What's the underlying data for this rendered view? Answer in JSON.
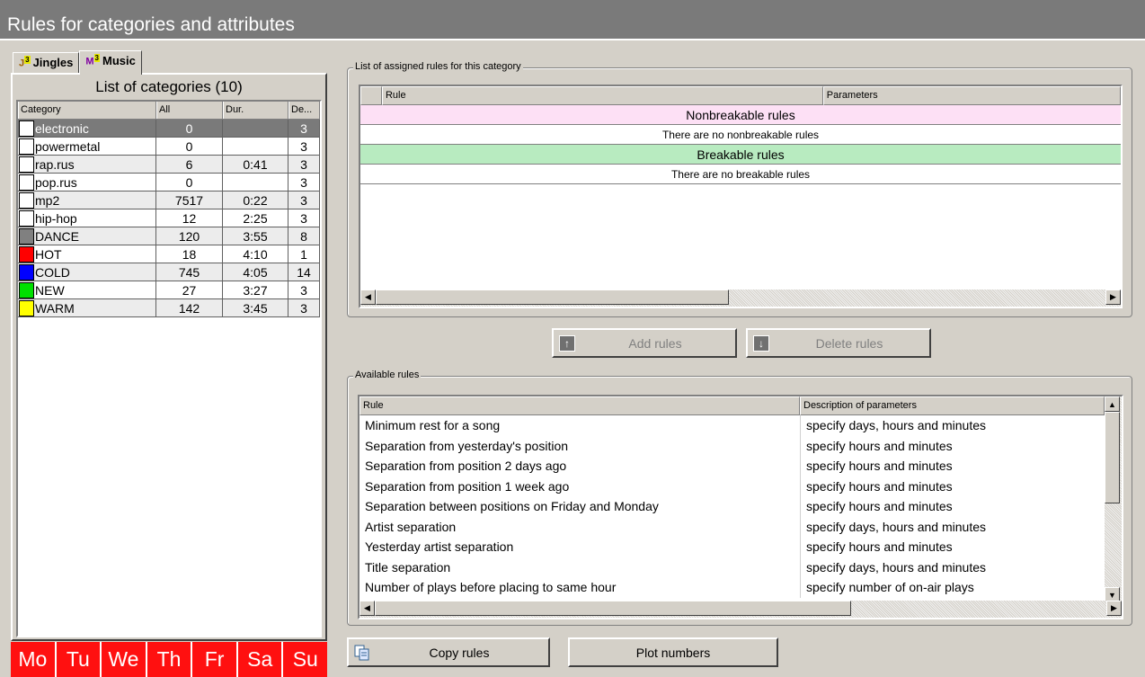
{
  "window": {
    "title": "Rules for categories and attributes"
  },
  "tabs": [
    {
      "label": "Jingles",
      "icon": "J"
    },
    {
      "label": "Music",
      "icon": "M",
      "active": true
    }
  ],
  "categories": {
    "title": "List of categories (10)",
    "columns": [
      "Category",
      "All",
      "Dur.",
      "De..."
    ],
    "rows": [
      {
        "name": "electronic",
        "all": "0",
        "dur": "",
        "de": "3",
        "color": "#ffffff",
        "selected": true
      },
      {
        "name": "powermetal",
        "all": "0",
        "dur": "",
        "de": "3",
        "color": "#ffffff"
      },
      {
        "name": "rap.rus",
        "all": "6",
        "dur": "0:41",
        "de": "3",
        "color": "#ffffff"
      },
      {
        "name": "pop.rus",
        "all": "0",
        "dur": "",
        "de": "3",
        "color": "#ffffff"
      },
      {
        "name": "mp2",
        "all": "7517",
        "dur": "0:22",
        "de": "3",
        "color": "#ffffff"
      },
      {
        "name": "hip-hop",
        "all": "12",
        "dur": "2:25",
        "de": "3",
        "color": "#ffffff"
      },
      {
        "name": "DANCE",
        "all": "120",
        "dur": "3:55",
        "de": "8",
        "color": "#808080"
      },
      {
        "name": "HOT",
        "all": "18",
        "dur": "4:10",
        "de": "1",
        "color": "#ff0000"
      },
      {
        "name": "COLD",
        "all": "745",
        "dur": "4:05",
        "de": "14",
        "color": "#0000ff"
      },
      {
        "name": "NEW",
        "all": "27",
        "dur": "3:27",
        "de": "3",
        "color": "#00e000"
      },
      {
        "name": "WARM",
        "all": "142",
        "dur": "3:45",
        "de": "3",
        "color": "#ffff00"
      }
    ]
  },
  "days": [
    "Mo",
    "Tu",
    "We",
    "Th",
    "Fr",
    "Sa",
    "Su"
  ],
  "assigned": {
    "group_label": "List of assigned rules for this category",
    "col_rule": "Rule",
    "col_params": "Parameters",
    "nonbreakable_header": "Nonbreakable rules",
    "nonbreakable_empty": "There are no nonbreakable rules",
    "breakable_header": "Breakable rules",
    "breakable_empty": "There are no breakable rules"
  },
  "buttons": {
    "add_rules": "Add rules",
    "delete_rules": "Delete rules",
    "copy_rules": "Copy rules",
    "plot_numbers": "Plot numbers"
  },
  "available": {
    "group_label": "Available rules",
    "col_rule": "Rule",
    "col_desc": "Description of parameters",
    "rows": [
      {
        "rule": "Minimum rest for a song",
        "desc": "specify days, hours and minutes"
      },
      {
        "rule": "Separation from yesterday's position",
        "desc": "specify hours and minutes"
      },
      {
        "rule": "Separation from position 2 days ago",
        "desc": "specify hours and minutes"
      },
      {
        "rule": "Separation from position 1 week ago",
        "desc": "specify hours and minutes"
      },
      {
        "rule": "Separation between positions on Friday and Monday",
        "desc": "specify hours and minutes"
      },
      {
        "rule": "Artist separation",
        "desc": "specify days, hours and minutes"
      },
      {
        "rule": "Yesterday artist separation",
        "desc": "specify hours and minutes"
      },
      {
        "rule": "Title separation",
        "desc": "specify days, hours and minutes"
      },
      {
        "rule": "Number of plays before placing to same hour",
        "desc": "specify number of on-air plays"
      }
    ]
  }
}
